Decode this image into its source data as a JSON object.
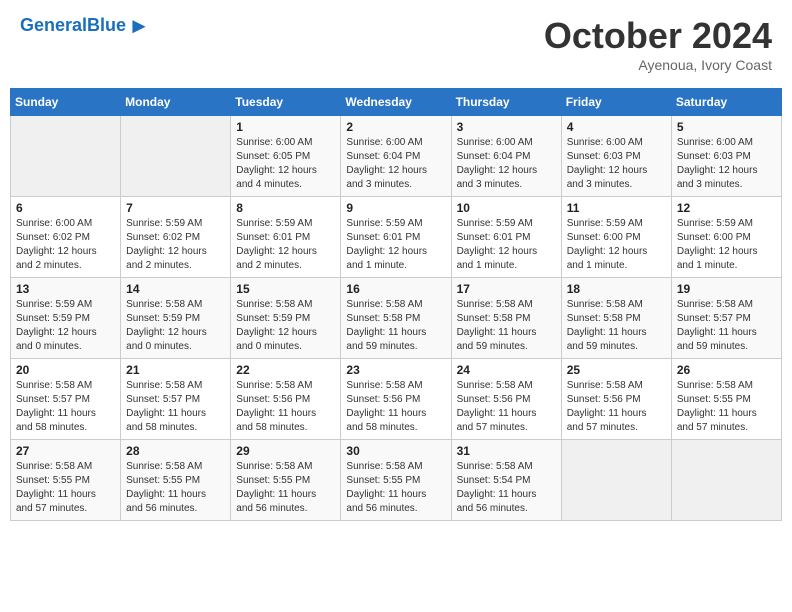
{
  "header": {
    "logo_general": "General",
    "logo_blue": "Blue",
    "month_title": "October 2024",
    "subtitle": "Ayenoua, Ivory Coast"
  },
  "weekdays": [
    "Sunday",
    "Monday",
    "Tuesday",
    "Wednesday",
    "Thursday",
    "Friday",
    "Saturday"
  ],
  "weeks": [
    [
      {
        "day": "",
        "info": ""
      },
      {
        "day": "",
        "info": ""
      },
      {
        "day": "1",
        "info": "Sunrise: 6:00 AM\nSunset: 6:05 PM\nDaylight: 12 hours and 4 minutes."
      },
      {
        "day": "2",
        "info": "Sunrise: 6:00 AM\nSunset: 6:04 PM\nDaylight: 12 hours and 3 minutes."
      },
      {
        "day": "3",
        "info": "Sunrise: 6:00 AM\nSunset: 6:04 PM\nDaylight: 12 hours and 3 minutes."
      },
      {
        "day": "4",
        "info": "Sunrise: 6:00 AM\nSunset: 6:03 PM\nDaylight: 12 hours and 3 minutes."
      },
      {
        "day": "5",
        "info": "Sunrise: 6:00 AM\nSunset: 6:03 PM\nDaylight: 12 hours and 3 minutes."
      }
    ],
    [
      {
        "day": "6",
        "info": "Sunrise: 6:00 AM\nSunset: 6:02 PM\nDaylight: 12 hours and 2 minutes."
      },
      {
        "day": "7",
        "info": "Sunrise: 5:59 AM\nSunset: 6:02 PM\nDaylight: 12 hours and 2 minutes."
      },
      {
        "day": "8",
        "info": "Sunrise: 5:59 AM\nSunset: 6:01 PM\nDaylight: 12 hours and 2 minutes."
      },
      {
        "day": "9",
        "info": "Sunrise: 5:59 AM\nSunset: 6:01 PM\nDaylight: 12 hours and 1 minute."
      },
      {
        "day": "10",
        "info": "Sunrise: 5:59 AM\nSunset: 6:01 PM\nDaylight: 12 hours and 1 minute."
      },
      {
        "day": "11",
        "info": "Sunrise: 5:59 AM\nSunset: 6:00 PM\nDaylight: 12 hours and 1 minute."
      },
      {
        "day": "12",
        "info": "Sunrise: 5:59 AM\nSunset: 6:00 PM\nDaylight: 12 hours and 1 minute."
      }
    ],
    [
      {
        "day": "13",
        "info": "Sunrise: 5:59 AM\nSunset: 5:59 PM\nDaylight: 12 hours and 0 minutes."
      },
      {
        "day": "14",
        "info": "Sunrise: 5:58 AM\nSunset: 5:59 PM\nDaylight: 12 hours and 0 minutes."
      },
      {
        "day": "15",
        "info": "Sunrise: 5:58 AM\nSunset: 5:59 PM\nDaylight: 12 hours and 0 minutes."
      },
      {
        "day": "16",
        "info": "Sunrise: 5:58 AM\nSunset: 5:58 PM\nDaylight: 11 hours and 59 minutes."
      },
      {
        "day": "17",
        "info": "Sunrise: 5:58 AM\nSunset: 5:58 PM\nDaylight: 11 hours and 59 minutes."
      },
      {
        "day": "18",
        "info": "Sunrise: 5:58 AM\nSunset: 5:58 PM\nDaylight: 11 hours and 59 minutes."
      },
      {
        "day": "19",
        "info": "Sunrise: 5:58 AM\nSunset: 5:57 PM\nDaylight: 11 hours and 59 minutes."
      }
    ],
    [
      {
        "day": "20",
        "info": "Sunrise: 5:58 AM\nSunset: 5:57 PM\nDaylight: 11 hours and 58 minutes."
      },
      {
        "day": "21",
        "info": "Sunrise: 5:58 AM\nSunset: 5:57 PM\nDaylight: 11 hours and 58 minutes."
      },
      {
        "day": "22",
        "info": "Sunrise: 5:58 AM\nSunset: 5:56 PM\nDaylight: 11 hours and 58 minutes."
      },
      {
        "day": "23",
        "info": "Sunrise: 5:58 AM\nSunset: 5:56 PM\nDaylight: 11 hours and 58 minutes."
      },
      {
        "day": "24",
        "info": "Sunrise: 5:58 AM\nSunset: 5:56 PM\nDaylight: 11 hours and 57 minutes."
      },
      {
        "day": "25",
        "info": "Sunrise: 5:58 AM\nSunset: 5:56 PM\nDaylight: 11 hours and 57 minutes."
      },
      {
        "day": "26",
        "info": "Sunrise: 5:58 AM\nSunset: 5:55 PM\nDaylight: 11 hours and 57 minutes."
      }
    ],
    [
      {
        "day": "27",
        "info": "Sunrise: 5:58 AM\nSunset: 5:55 PM\nDaylight: 11 hours and 57 minutes."
      },
      {
        "day": "28",
        "info": "Sunrise: 5:58 AM\nSunset: 5:55 PM\nDaylight: 11 hours and 56 minutes."
      },
      {
        "day": "29",
        "info": "Sunrise: 5:58 AM\nSunset: 5:55 PM\nDaylight: 11 hours and 56 minutes."
      },
      {
        "day": "30",
        "info": "Sunrise: 5:58 AM\nSunset: 5:55 PM\nDaylight: 11 hours and 56 minutes."
      },
      {
        "day": "31",
        "info": "Sunrise: 5:58 AM\nSunset: 5:54 PM\nDaylight: 11 hours and 56 minutes."
      },
      {
        "day": "",
        "info": ""
      },
      {
        "day": "",
        "info": ""
      }
    ]
  ]
}
